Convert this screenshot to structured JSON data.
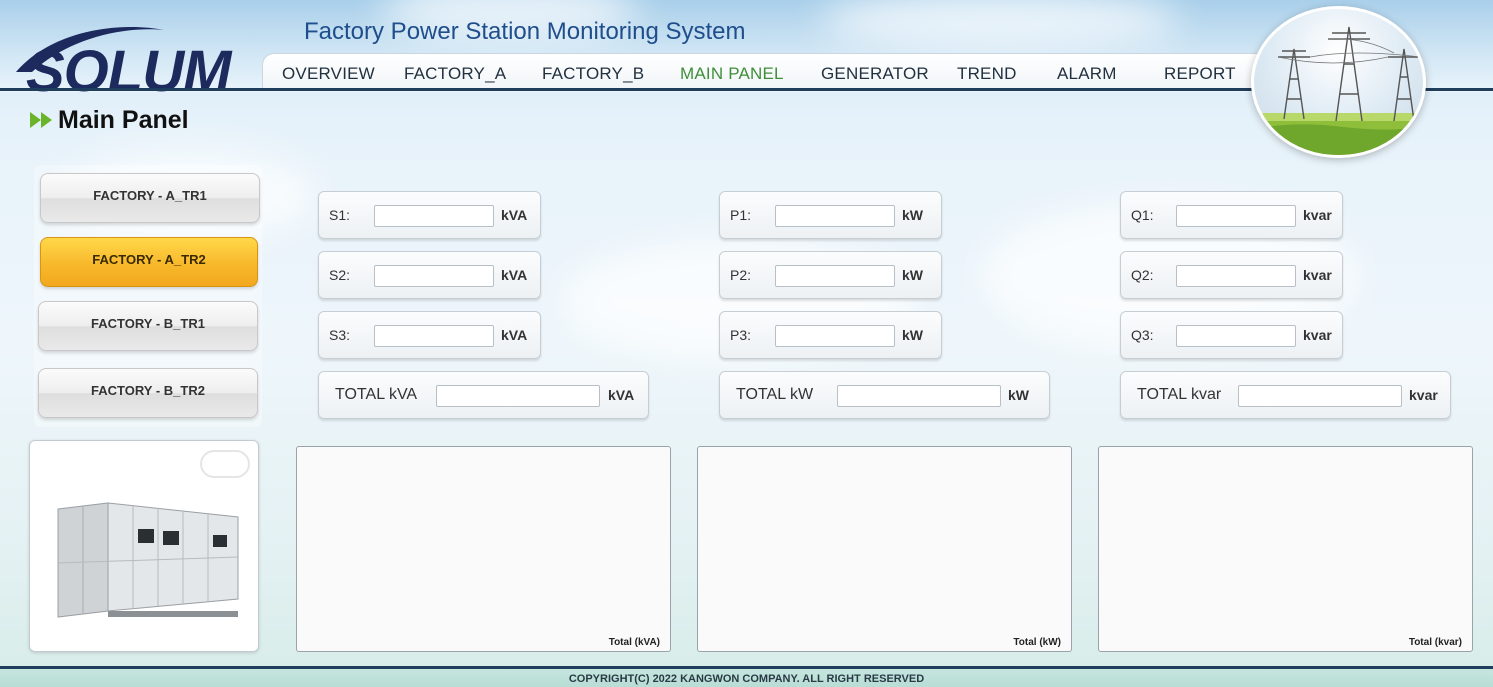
{
  "header": {
    "logo_text": "SOLUM",
    "app_title": "Factory Power Station Monitoring System"
  },
  "nav": [
    {
      "label": "OVERVIEW",
      "active": false
    },
    {
      "label": "FACTORY_A",
      "active": false
    },
    {
      "label": "FACTORY_B",
      "active": false
    },
    {
      "label": "MAIN PANEL",
      "active": true
    },
    {
      "label": "GENERATOR",
      "active": false
    },
    {
      "label": "TREND",
      "active": false
    },
    {
      "label": "ALARM",
      "active": false
    },
    {
      "label": "REPORT",
      "active": false
    }
  ],
  "page_title": "Main Panel",
  "sidebar": [
    {
      "label": "FACTORY - A_TR1",
      "active": false
    },
    {
      "label": "FACTORY - A_TR2",
      "active": true
    },
    {
      "label": "FACTORY - B_TR1",
      "active": false
    },
    {
      "label": "FACTORY - B_TR2",
      "active": false
    }
  ],
  "meters": {
    "s1": {
      "label": "S1:",
      "unit": "kVA",
      "value": ""
    },
    "s2": {
      "label": "S2:",
      "unit": "kVA",
      "value": ""
    },
    "s3": {
      "label": "S3:",
      "unit": "kVA",
      "value": ""
    },
    "s_total": {
      "label": "TOTAL kVA",
      "unit": "kVA",
      "value": ""
    },
    "p1": {
      "label": "P1:",
      "unit": "kW",
      "value": ""
    },
    "p2": {
      "label": "P2:",
      "unit": "kW",
      "value": ""
    },
    "p3": {
      "label": "P3:",
      "unit": "kW",
      "value": ""
    },
    "p_total": {
      "label": "TOTAL kW",
      "unit": "kW",
      "value": ""
    },
    "q1": {
      "label": "Q1:",
      "unit": "kvar",
      "value": ""
    },
    "q2": {
      "label": "Q2:",
      "unit": "kvar",
      "value": ""
    },
    "q3": {
      "label": "Q3:",
      "unit": "kvar",
      "value": ""
    },
    "q_total": {
      "label": "TOTAL kvar",
      "unit": "kvar",
      "value": ""
    }
  },
  "charts": {
    "kva": {
      "caption": "Total (kVA)"
    },
    "kw": {
      "caption": "Total (kW)"
    },
    "kvar": {
      "caption": "Total (kvar)"
    }
  },
  "footer": "COPYRIGHT(C) 2022 KANGWON COMPANY. ALL RIGHT RESERVED",
  "colors": {
    "accent_active_nav": "#3f8f3a",
    "active_button": "#f8b82b",
    "header_dark": "#1f3d5c"
  }
}
